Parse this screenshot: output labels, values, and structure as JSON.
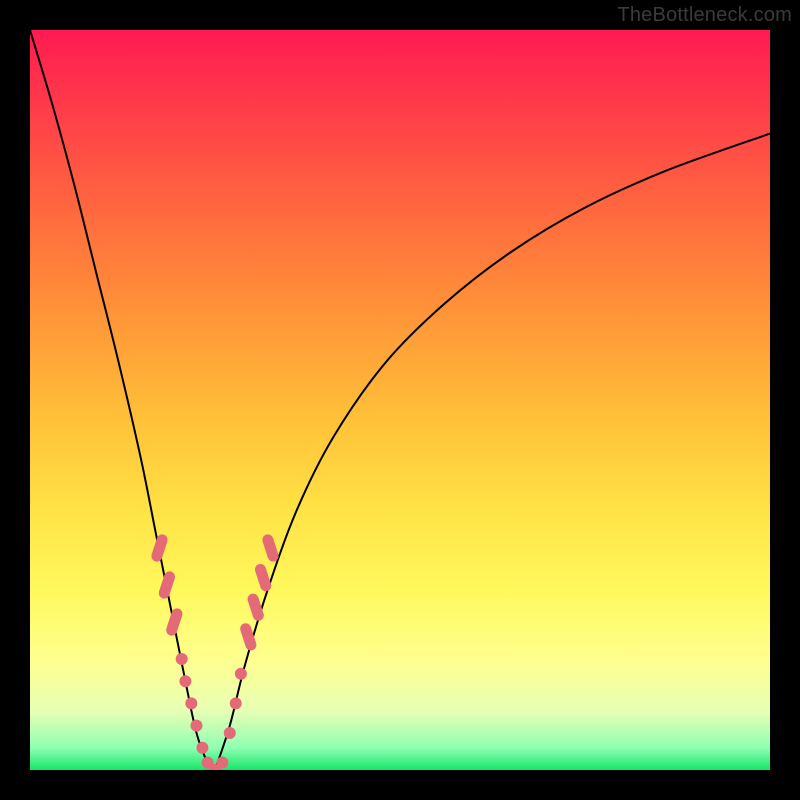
{
  "watermark": "TheBottleneck.com",
  "colors": {
    "background_frame": "#000000",
    "gradient_top": "#ff1a52",
    "gradient_bottom": "#18e56a",
    "curve": "#000000",
    "markers": "#e46a78"
  },
  "chart_data": {
    "type": "line",
    "title": "",
    "xlabel": "",
    "ylabel": "",
    "xlim": [
      0,
      100
    ],
    "ylim": [
      0,
      100
    ],
    "grid": false,
    "legend": false,
    "description": "Two curves descending from high bottleneck percentage to near-zero and rising again, with a narrow optimal (green) zone near the minimum. Pink markers indicate sampled points near the trough.",
    "series": [
      {
        "name": "left-curve",
        "x": [
          0,
          3,
          6,
          9,
          12,
          15,
          17,
          19,
          21,
          22.5,
          24,
          25
        ],
        "y": [
          100,
          90,
          79,
          67,
          55,
          42,
          32,
          22,
          12,
          5,
          1,
          0
        ]
      },
      {
        "name": "right-curve",
        "x": [
          25,
          27,
          29,
          32,
          36,
          41,
          48,
          56,
          65,
          75,
          86,
          100
        ],
        "y": [
          0,
          6,
          14,
          24,
          35,
          45,
          55,
          63,
          70,
          76,
          81,
          86
        ]
      }
    ],
    "markers": {
      "name": "sample-points",
      "comment": "Pink dots/capsules clustered around the V-shaped minimum",
      "points": [
        {
          "x": 17.5,
          "y": 30
        },
        {
          "x": 18.5,
          "y": 25
        },
        {
          "x": 19.5,
          "y": 20
        },
        {
          "x": 20.5,
          "y": 15
        },
        {
          "x": 21.0,
          "y": 12
        },
        {
          "x": 21.8,
          "y": 9
        },
        {
          "x": 22.5,
          "y": 6
        },
        {
          "x": 23.3,
          "y": 3
        },
        {
          "x": 24.0,
          "y": 1
        },
        {
          "x": 25.0,
          "y": 0
        },
        {
          "x": 26.0,
          "y": 1
        },
        {
          "x": 27.0,
          "y": 5
        },
        {
          "x": 27.8,
          "y": 9
        },
        {
          "x": 28.5,
          "y": 13
        },
        {
          "x": 29.5,
          "y": 18
        },
        {
          "x": 30.5,
          "y": 22
        },
        {
          "x": 31.5,
          "y": 26
        },
        {
          "x": 32.5,
          "y": 30
        }
      ]
    }
  }
}
